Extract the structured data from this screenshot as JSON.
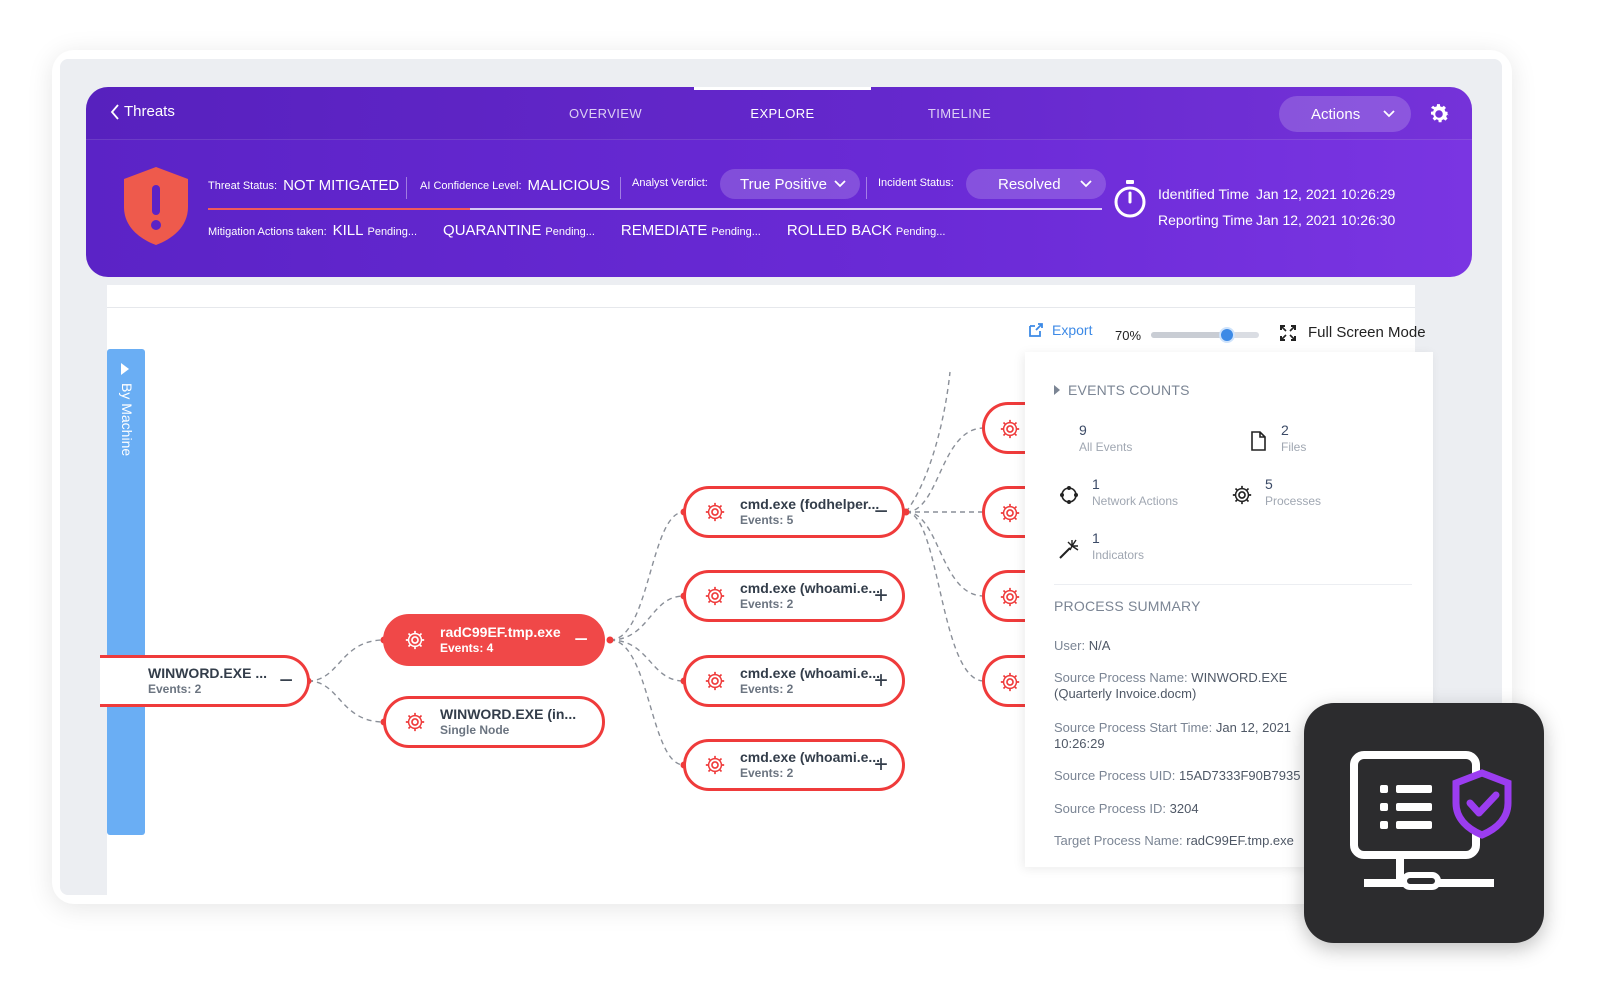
{
  "header": {
    "back_label": "Threats",
    "tabs": [
      {
        "label": "OVERVIEW"
      },
      {
        "label": "EXPLORE",
        "active": true
      },
      {
        "label": "TIMELINE"
      }
    ],
    "actions_label": "Actions",
    "threat_status_label": "Threat Status:",
    "threat_status_value": "NOT MITIGATED",
    "ai_confidence_label": "AI Confidence Level:",
    "ai_confidence_value": "MALICIOUS",
    "analyst_verdict_label": "Analyst Verdict:",
    "analyst_verdict_value": "True Positive",
    "incident_status_label": "Incident Status:",
    "incident_status_value": "Resolved",
    "mitigation_label": "Mitigation Actions taken:",
    "mitigation_actions": [
      {
        "action": "KILL",
        "state": "Pending..."
      },
      {
        "action": "QUARANTINE",
        "state": "Pending..."
      },
      {
        "action": "REMEDIATE",
        "state": "Pending..."
      },
      {
        "action": "ROLLED BACK",
        "state": "Pending..."
      }
    ],
    "identified_time_label": "Identified Time",
    "identified_time_value": "Jan 12, 2021 10:26:29",
    "reporting_time_label": "Reporting Time",
    "reporting_time_value": "Jan 12, 2021 10:26:30"
  },
  "toolbar": {
    "side_tab_label": "By Machine",
    "export_label": "Export",
    "zoom_label": "70%",
    "zoom_fraction": 0.7,
    "fullscreen_label": "Full Screen Mode"
  },
  "graph": {
    "nodes": {
      "winword_root": {
        "title": "WINWORD.EXE ...",
        "subtitle": "Events: 2"
      },
      "radc": {
        "title": "radC99EF.tmp.exe",
        "subtitle": "Events: 4"
      },
      "winword_child": {
        "title": "WINWORD.EXE (in...",
        "subtitle": "Single Node"
      },
      "cmd1": {
        "title": "cmd.exe (fodhelper....",
        "subtitle": "Events: 5"
      },
      "cmd2": {
        "title": "cmd.exe (whoami.e...",
        "subtitle": "Events: 2"
      },
      "cmd3": {
        "title": "cmd.exe (whoami.e...",
        "subtitle": "Events: 2"
      },
      "cmd4": {
        "title": "cmd.exe (whoami.e...",
        "subtitle": "Events: 2"
      }
    }
  },
  "panel": {
    "events_counts_title": "EVENTS COUNTS",
    "counts": [
      {
        "value": "9",
        "label": "All Events",
        "icon": "none"
      },
      {
        "value": "2",
        "label": "Files",
        "icon": "file-icon"
      },
      {
        "value": "1",
        "label": "Network Actions",
        "icon": "network-icon"
      },
      {
        "value": "5",
        "label": "Processes",
        "icon": "gear-icon"
      },
      {
        "value": "1",
        "label": "Indicators",
        "icon": "indicator-icon"
      }
    ],
    "process_summary_title": "PROCESS SUMMARY",
    "summary": [
      {
        "key": "User:",
        "value": "N/A"
      },
      {
        "key": "Source Process Name:",
        "value": "WINWORD.EXE (Quarterly Invoice.docm)"
      },
      {
        "key": "Source Process Start Time:",
        "value": "Jan 12, 2021 10:26:29"
      },
      {
        "key": "Source Process UID:",
        "value": "15AD7333F90B7935"
      },
      {
        "key": "Source Process ID:",
        "value": "3204"
      },
      {
        "key": "Target Process Name:",
        "value": "radC99EF.tmp.exe"
      }
    ]
  },
  "colors": {
    "header_start": "#5b23c6",
    "header_end": "#7a35e2",
    "node_red": "#ef3b3b",
    "accent_blue": "#3d8ae6",
    "side_tab_blue": "#6aaef4",
    "badge_dark": "#2c2c2e",
    "badge_purple": "#9b3df0"
  }
}
